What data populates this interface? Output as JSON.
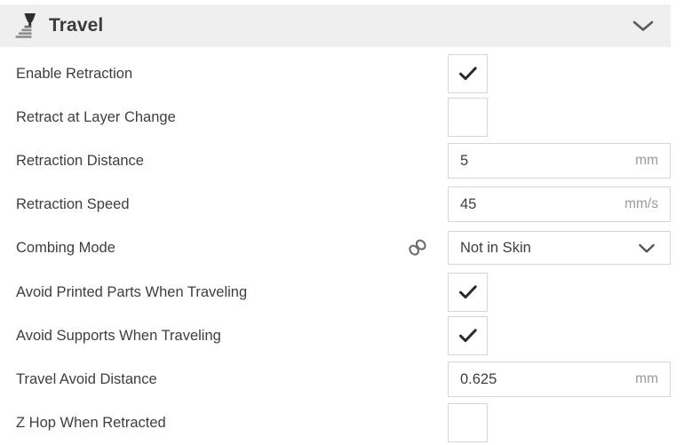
{
  "section": {
    "title": "Travel",
    "icon": "travel-nozzle-icon",
    "collapse_icon": "chevron-down-icon",
    "header_bg": "#efefef",
    "text_color": "#3e3e3e",
    "unit_color": "#9a9a9a",
    "border_color": "#d6d6d6"
  },
  "rows": [
    {
      "label": "Enable Retraction",
      "control": "checkbox",
      "checked": true,
      "linked": false,
      "name": "enable-retraction"
    },
    {
      "label": "Retract at Layer Change",
      "control": "checkbox",
      "checked": false,
      "linked": false,
      "name": "retract-at-layer-change"
    },
    {
      "label": "Retraction Distance",
      "control": "textfield",
      "value": "5",
      "unit": "mm",
      "linked": false,
      "name": "retraction-distance"
    },
    {
      "label": "Retraction Speed",
      "control": "textfield",
      "value": "45",
      "unit": "mm/s",
      "linked": false,
      "name": "retraction-speed"
    },
    {
      "label": "Combing Mode",
      "control": "dropdown",
      "value": "Not in Skin",
      "linked": true,
      "link_icon": "chain-link-icon",
      "dropdown_icon": "chevron-down-icon",
      "name": "combing-mode"
    },
    {
      "label": "Avoid Printed Parts When Traveling",
      "control": "checkbox",
      "checked": true,
      "linked": false,
      "name": "avoid-printed-parts-when-traveling"
    },
    {
      "label": "Avoid Supports When Traveling",
      "control": "checkbox",
      "checked": true,
      "linked": false,
      "name": "avoid-supports-when-traveling"
    },
    {
      "label": "Travel Avoid Distance",
      "control": "textfield",
      "value": "0.625",
      "unit": "mm",
      "linked": false,
      "name": "travel-avoid-distance"
    },
    {
      "label": "Z Hop When Retracted",
      "control": "checkbox",
      "checked": false,
      "linked": false,
      "name": "z-hop-when-retracted"
    }
  ]
}
